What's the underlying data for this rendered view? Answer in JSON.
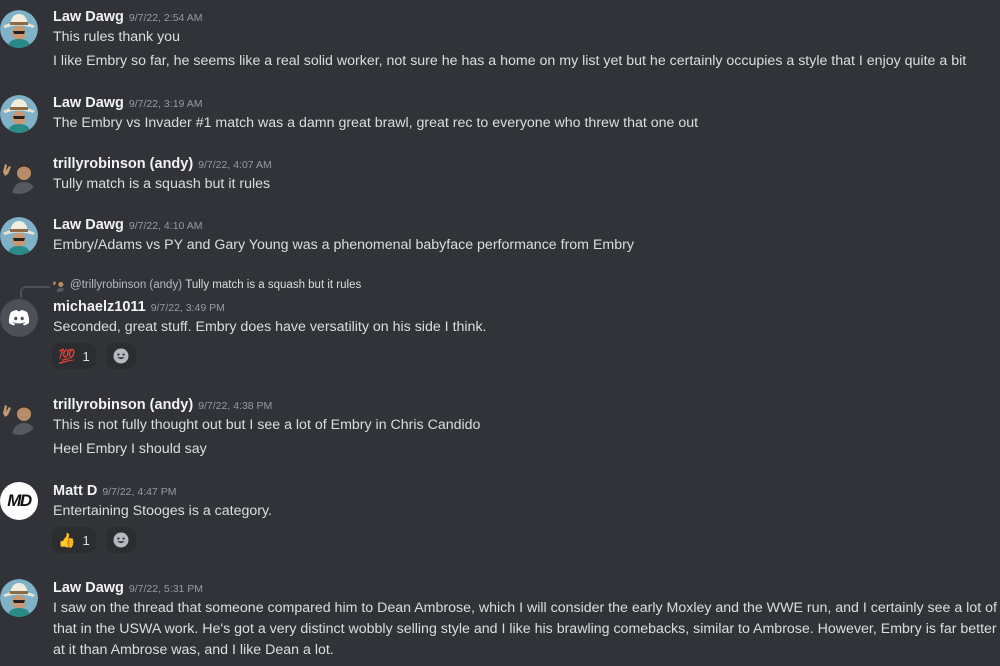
{
  "messages": [
    {
      "user": "Law Dawg",
      "timestamp": "9/7/22, 2:54 AM",
      "lines": [
        "This rules thank you",
        "I like Embry so far, he seems like a real solid worker, not sure he has a home on my list yet but he certainly occupies a style that I enjoy quite a bit"
      ]
    },
    {
      "user": "Law Dawg",
      "timestamp": "9/7/22, 3:19 AM",
      "lines": [
        "The Embry vs Invader #1 match was a damn great brawl, great rec to everyone who threw that one out"
      ]
    },
    {
      "user": "trillyrobinson (andy)",
      "timestamp": "9/7/22, 4:07 AM",
      "lines": [
        "Tully match is a squash but it rules"
      ]
    },
    {
      "user": "Law Dawg",
      "timestamp": "9/7/22, 4:10 AM",
      "lines": [
        "Embry/Adams vs PY and Gary Young was a phenomenal babyface performance from Embry"
      ]
    },
    {
      "reply_to": "@trillyrobinson (andy)",
      "reply_text": "Tully match is a squash but it rules",
      "user": "michaelz1011",
      "timestamp": "9/7/22, 3:49 PM",
      "lines": [
        "Seconded, great stuff. Embry does have versatility on his side I think."
      ],
      "reaction": {
        "emoji": "💯",
        "count": "1"
      }
    },
    {
      "user": "trillyrobinson (andy)",
      "timestamp": "9/7/22, 4:38 PM",
      "lines": [
        "This is not fully thought out but I see a lot of Embry in Chris Candido",
        "Heel Embry I should say"
      ]
    },
    {
      "user": "Matt D",
      "timestamp": "9/7/22, 4:47 PM",
      "lines": [
        "Entertaining Stooges is a category."
      ],
      "reaction": {
        "emoji": "👍",
        "count": "1"
      }
    },
    {
      "user": "Law Dawg",
      "timestamp": "9/7/22, 5:31 PM",
      "lines": [
        "I saw on the thread that someone compared him to Dean Ambrose, which I will consider the early Moxley and the WWE run, and I certainly see a lot of that in the USWA work. He's got a very distinct wobbly selling style and I like his brawling comebacks, similar to Ambrose. However, Embry is far better at it than Ambrose was, and I like Dean a lot."
      ]
    }
  ],
  "avatars": {
    "matt_d_monogram": "MD"
  },
  "icons": [
    "cowboy-avatar-icon",
    "rock-hand-avatar-icon",
    "discord-logo-icon",
    "add-reaction-icon"
  ],
  "colors": {
    "background": "#313338",
    "text": "#dbdee1",
    "username": "#f2f3f5",
    "timestamp": "#949ba4",
    "reaction_bg": "#2b2d31",
    "discord_avatar": "#4e5058"
  }
}
